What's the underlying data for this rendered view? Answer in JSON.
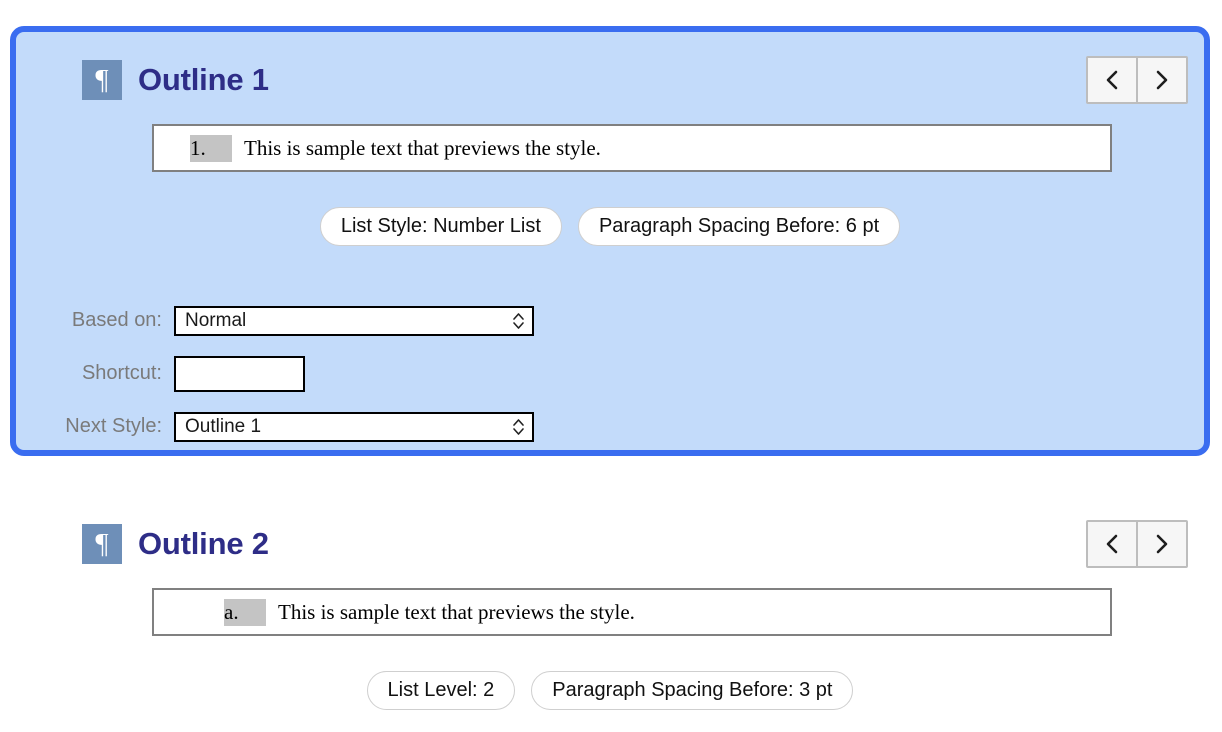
{
  "page": {
    "background": "#ffffff",
    "selection_color": "#3a6df0",
    "selected_panel_fill": "#c3dbfa",
    "title_color": "#2e2d87",
    "icon_tile_color": "#6e8fb8"
  },
  "styles": [
    {
      "selected": true,
      "icon": "paragraph-mark-icon",
      "icon_glyph": "¶",
      "title": "Outline 1",
      "nav": {
        "prev_label": "‹",
        "prev_icon": "chevron-left-icon",
        "next_label": "›",
        "next_icon": "chevron-right-icon"
      },
      "preview": {
        "marker": "1.",
        "text": "This is sample text that previews the style."
      },
      "attributes": [
        "List Style: Number List",
        "Paragraph Spacing Before: 6 pt"
      ],
      "fields": [
        {
          "label": "Based on:",
          "type": "select",
          "value": "Normal",
          "name": "based-on-select"
        },
        {
          "label": "Shortcut:",
          "type": "text",
          "value": "",
          "placeholder": "",
          "name": "shortcut-input"
        },
        {
          "label": "Next Style:",
          "type": "select",
          "value": "Outline 1",
          "name": "next-style-select"
        }
      ]
    },
    {
      "selected": false,
      "icon": "paragraph-mark-icon",
      "icon_glyph": "¶",
      "title": "Outline 2",
      "nav": {
        "prev_label": "‹",
        "prev_icon": "chevron-left-icon",
        "next_label": "›",
        "next_icon": "chevron-right-icon"
      },
      "preview": {
        "marker": "a.",
        "text": "This is sample text that previews the style."
      },
      "attributes": [
        "List Level: 2",
        "Paragraph Spacing Before: 3 pt"
      ],
      "fields": []
    }
  ]
}
